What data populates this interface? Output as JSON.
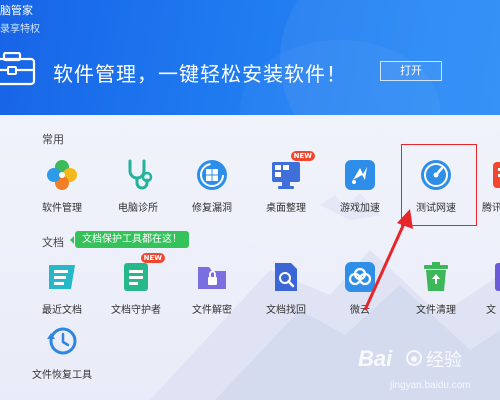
{
  "header": {
    "app_title": "脑管家",
    "member_text": "录享特权",
    "headline": "软件管理，一键轻松安装软件！",
    "open_button": "打开",
    "icons": {
      "toolbox": "toolbox-icon"
    }
  },
  "sections": {
    "common_label": "常用",
    "docs_label": "文档",
    "docs_tip": "文档保护工具都在这！"
  },
  "common_tools": [
    {
      "name": "软件管理",
      "icon": "clover-icon"
    },
    {
      "name": "电脑诊所",
      "icon": "stethoscope-icon"
    },
    {
      "name": "修复漏洞",
      "icon": "windows-repair-icon"
    },
    {
      "name": "桌面整理",
      "icon": "desktop-icon",
      "badge": "NEW"
    },
    {
      "name": "游戏加速",
      "icon": "game-boost-icon"
    },
    {
      "name": "测试网速",
      "icon": "speedometer-icon"
    },
    {
      "name": "腾讯",
      "icon": "tencent-icon"
    }
  ],
  "doc_tools": [
    {
      "name": "最近文档",
      "icon": "recent-docs-icon"
    },
    {
      "name": "文档守护者",
      "icon": "doc-guardian-icon",
      "badge": "NEW"
    },
    {
      "name": "文件解密",
      "icon": "folder-lock-icon"
    },
    {
      "name": "文档找回",
      "icon": "doc-search-icon"
    },
    {
      "name": "微云",
      "icon": "weiyun-icon"
    },
    {
      "name": "文件清理",
      "icon": "trash-icon"
    },
    {
      "name": "文",
      "icon": "file-icon"
    },
    {
      "name": "文件恢复工具",
      "icon": "file-restore-icon"
    }
  ],
  "watermark": {
    "brand": "Bai",
    "brand2": "经验",
    "url": "jingyan.baidu.com"
  },
  "colors": {
    "header_blue": "#1f7af0",
    "accent_green": "#35c25a",
    "highlight_red": "#e8262a",
    "new_badge": "#f0472e"
  }
}
